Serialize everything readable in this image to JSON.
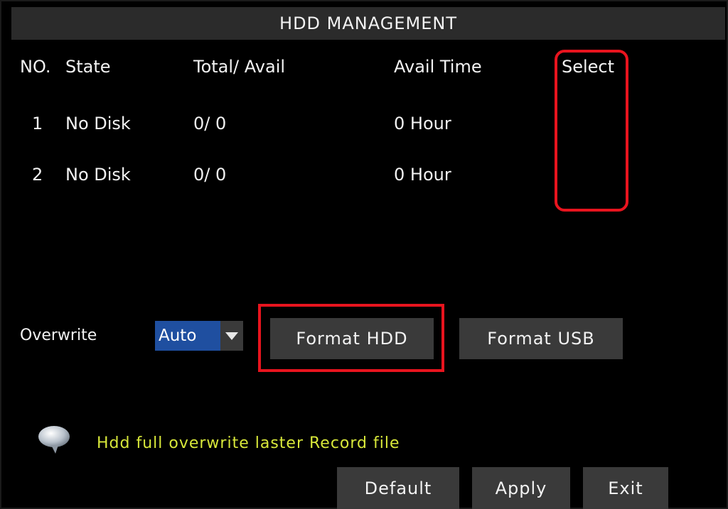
{
  "title": "HDD MANAGEMENT",
  "table": {
    "headers": {
      "no": "NO.",
      "state": "State",
      "total": "Total/ Avail",
      "time": "Avail Time",
      "select": "Select"
    },
    "rows": [
      {
        "no": "1",
        "state": "No Disk",
        "total": "0/ 0",
        "time": "0 Hour"
      },
      {
        "no": "2",
        "state": "No Disk",
        "total": "0/ 0",
        "time": "0 Hour"
      }
    ]
  },
  "overwrite": {
    "label": "Overwrite",
    "value": "Auto"
  },
  "buttons": {
    "format_hdd": "Format HDD",
    "format_usb": "Format USB",
    "default": "Default",
    "apply": "Apply",
    "exit": "Exit"
  },
  "hint": {
    "text": "Hdd full overwrite laster Record file",
    "icon": "speech-bubble-icon"
  },
  "colors": {
    "highlight": "#e8141e",
    "selected_value": "#1f4fa0",
    "hint_text": "#d8e83a",
    "button": "#3a3a3a"
  }
}
